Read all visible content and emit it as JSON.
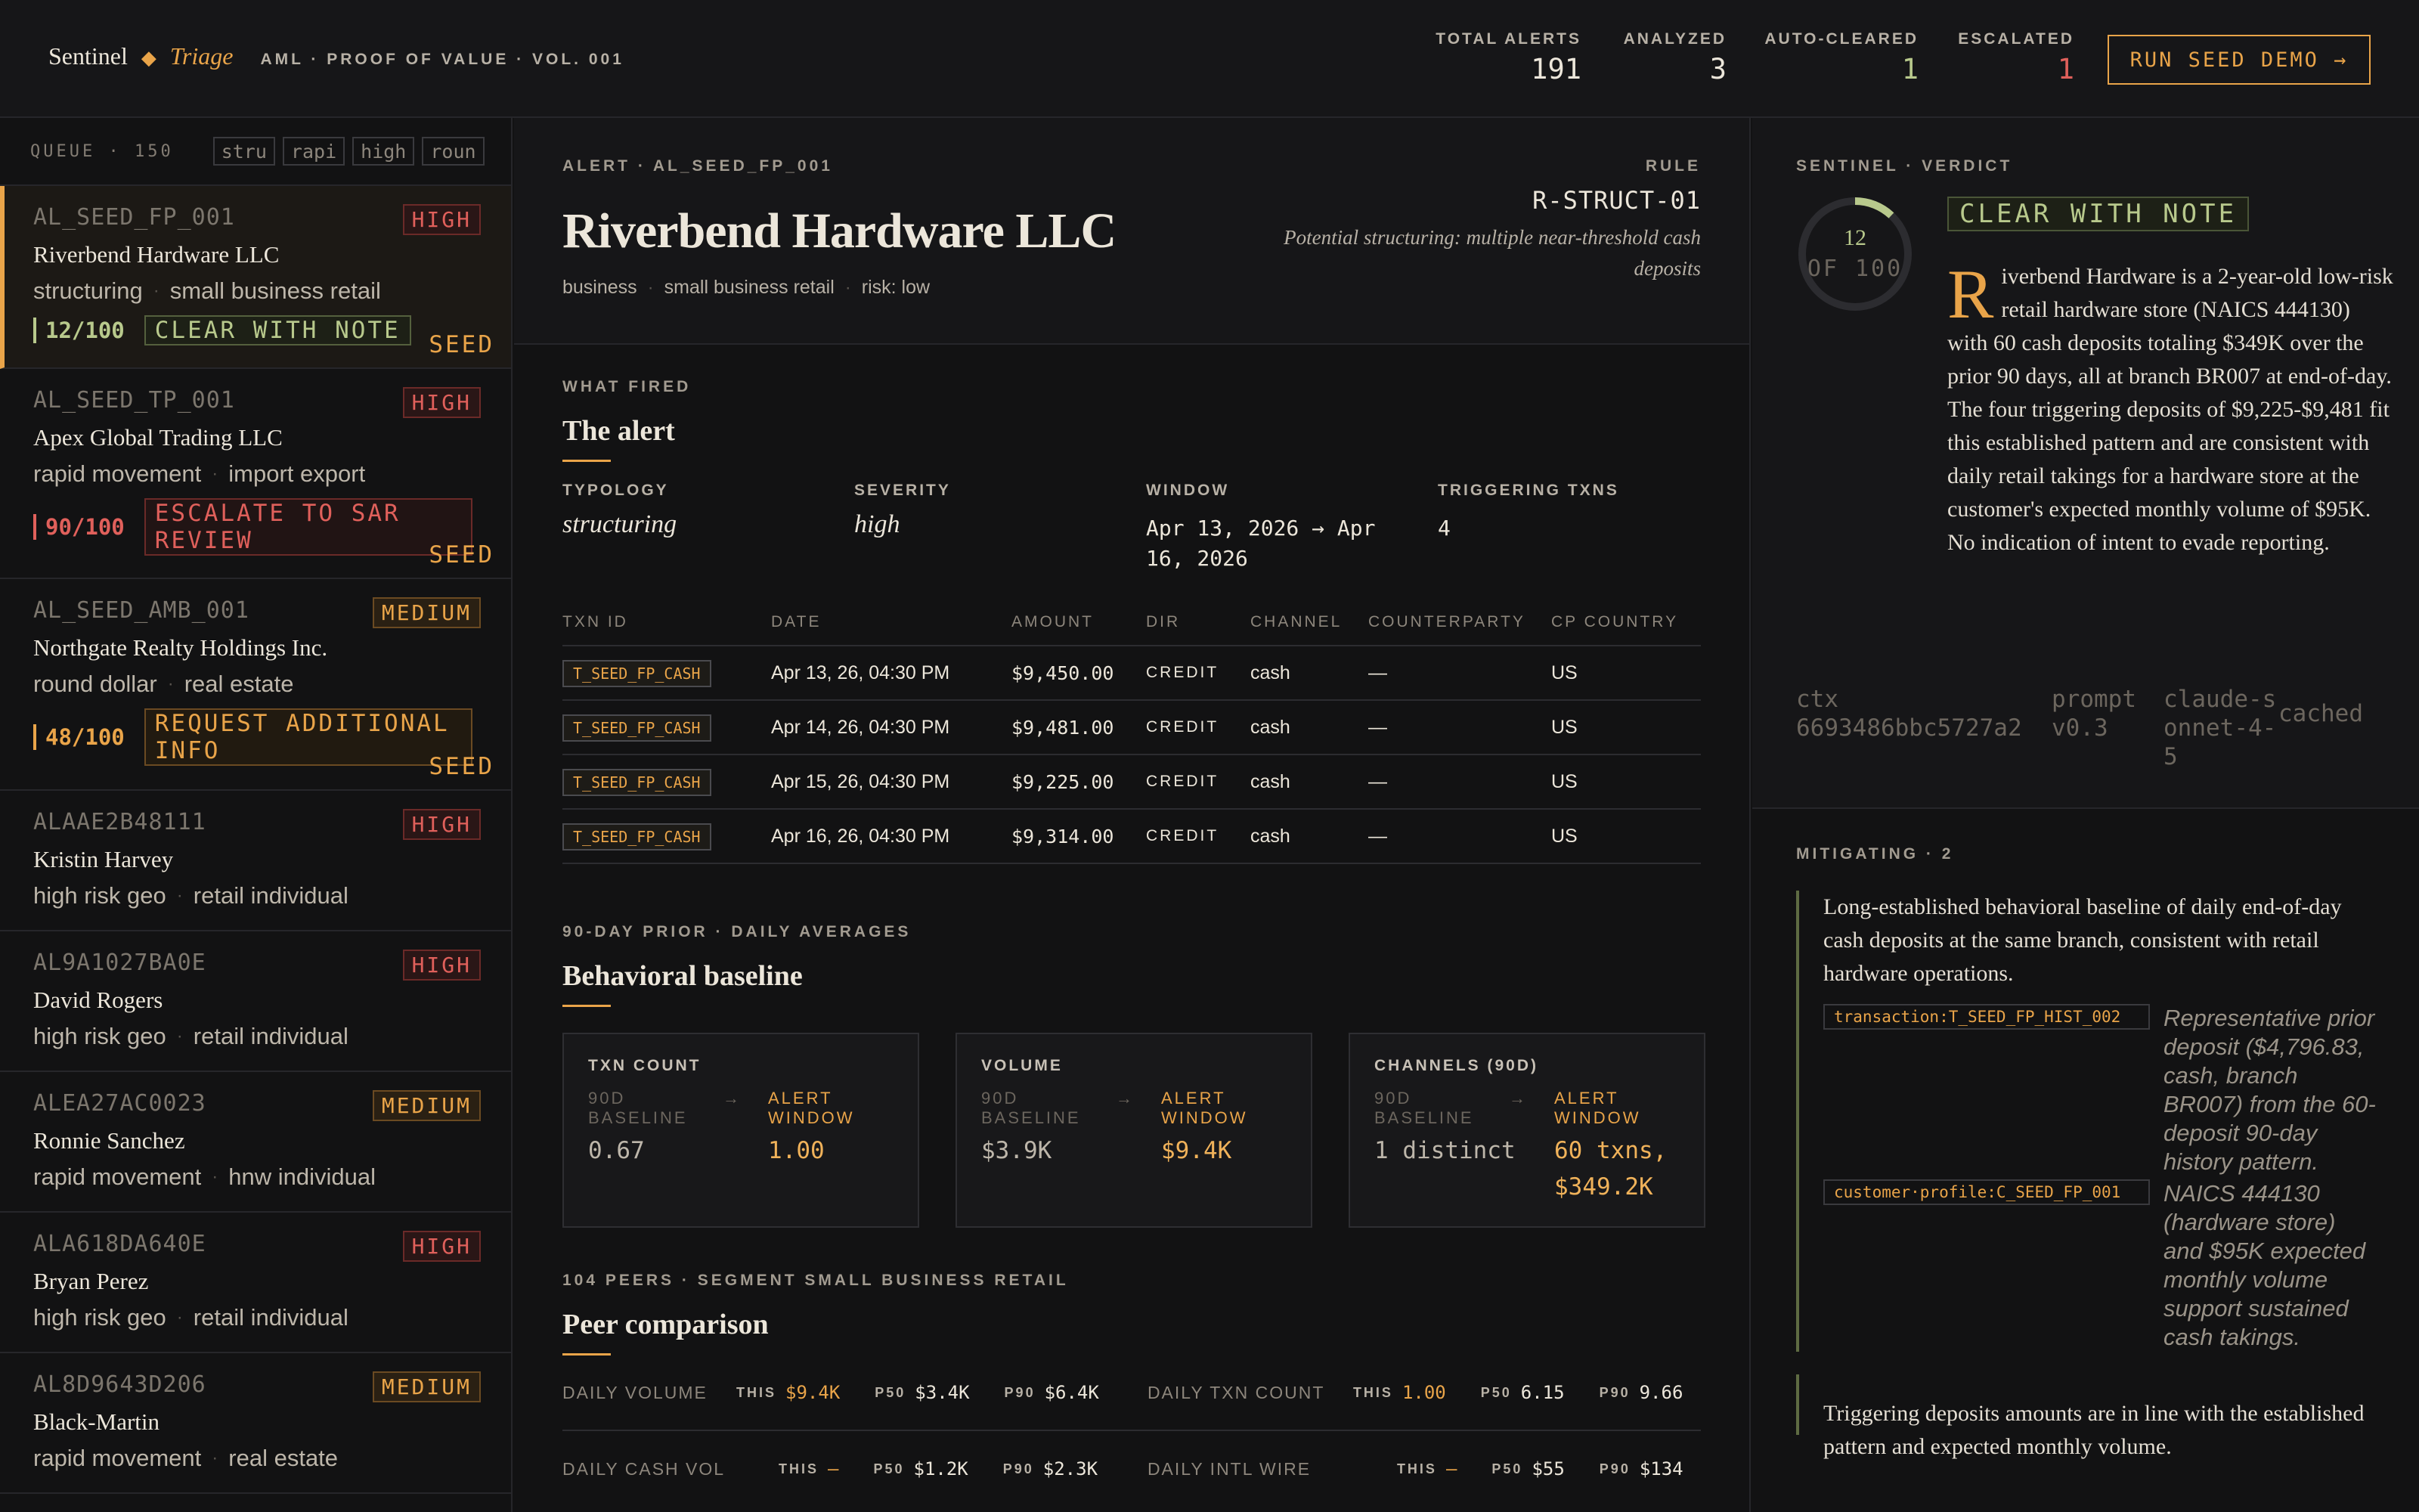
{
  "header": {
    "brand_name": "Sentinel",
    "brand_mark": "◆",
    "brand_sub": "Triage",
    "tagline": "AML · PROOF OF VALUE · VOL. 001",
    "stats": [
      {
        "label": "TOTAL ALERTS",
        "value": "191",
        "color": "#ece6da"
      },
      {
        "label": "ANALYZED",
        "value": "3",
        "color": "#ece6da"
      },
      {
        "label": "AUTO-CLEARED",
        "value": "1",
        "color": "#b8c98c"
      },
      {
        "label": "ESCALATED",
        "value": "1",
        "color": "#e0605b"
      }
    ],
    "run_button": "RUN SEED DEMO →"
  },
  "queue": {
    "label": "QUEUE · 150",
    "filters": [
      "stru",
      "rapi",
      "high",
      "roun"
    ],
    "items": [
      {
        "id": "AL_SEED_FP_001",
        "severity": "HIGH",
        "name": "Riverbend Hardware LLC",
        "tag1": "structuring",
        "tag2": "small business retail",
        "score": "12/100",
        "decision": "CLEAR WITH NOTE",
        "seed": "SEED"
      },
      {
        "id": "AL_SEED_TP_001",
        "severity": "HIGH",
        "name": "Apex Global Trading LLC",
        "tag1": "rapid movement",
        "tag2": "import export",
        "score": "90/100",
        "decision": "ESCALATE TO SAR REVIEW",
        "seed": "SEED"
      },
      {
        "id": "AL_SEED_AMB_001",
        "severity": "MEDIUM",
        "name": "Northgate Realty Holdings Inc.",
        "tag1": "round dollar",
        "tag2": "real estate",
        "score": "48/100",
        "decision": "REQUEST ADDITIONAL INFO",
        "seed": "SEED"
      },
      {
        "id": "ALAAE2B48111",
        "severity": "HIGH",
        "name": "Kristin Harvey",
        "tag1": "high risk geo",
        "tag2": "retail individual"
      },
      {
        "id": "AL9A1027BA0E",
        "severity": "HIGH",
        "name": "David Rogers",
        "tag1": "high risk geo",
        "tag2": "retail individual"
      },
      {
        "id": "ALEA27AC0023",
        "severity": "MEDIUM",
        "name": "Ronnie Sanchez",
        "tag1": "rapid movement",
        "tag2": "hnw individual"
      },
      {
        "id": "ALA618DA640E",
        "severity": "HIGH",
        "name": "Bryan Perez",
        "tag1": "high risk geo",
        "tag2": "retail individual"
      },
      {
        "id": "AL8D9643D206",
        "severity": "MEDIUM",
        "name": "Black-Martin",
        "tag1": "rapid movement",
        "tag2": "real estate"
      }
    ]
  },
  "alert": {
    "eyebrow": "ALERT · AL_SEED_FP_001",
    "title": "Riverbend Hardware LLC",
    "meta": [
      "business",
      "small business retail",
      "risk: low"
    ],
    "rule_label": "RULE",
    "rule_code": "R-STRUCT-01",
    "rule_desc": "Potential structuring: multiple near-threshold cash deposits"
  },
  "what_fired": {
    "eyebrow": "WHAT FIRED",
    "title": "The alert",
    "fields": [
      {
        "label": "TYPOLOGY",
        "value": "structuring"
      },
      {
        "label": "SEVERITY",
        "value": "high"
      },
      {
        "label": "WINDOW",
        "value": "Apr 13, 2026 → Apr 16, 2026"
      },
      {
        "label": "TRIGGERING TXNS",
        "value": "4"
      }
    ],
    "columns": [
      "TXN ID",
      "DATE",
      "AMOUNT",
      "DIR",
      "CHANNEL",
      "COUNTERPARTY",
      "CP COUNTRY"
    ],
    "rows": [
      [
        "T_SEED_FP_CASH",
        "Apr 13, 26, 04:30 PM",
        "$9,450.00",
        "CREDIT",
        "cash",
        "—",
        "US"
      ],
      [
        "T_SEED_FP_CASH",
        "Apr 14, 26, 04:30 PM",
        "$9,481.00",
        "CREDIT",
        "cash",
        "—",
        "US"
      ],
      [
        "T_SEED_FP_CASH",
        "Apr 15, 26, 04:30 PM",
        "$9,225.00",
        "CREDIT",
        "cash",
        "—",
        "US"
      ],
      [
        "T_SEED_FP_CASH",
        "Apr 16, 26, 04:30 PM",
        "$9,314.00",
        "CREDIT",
        "cash",
        "—",
        "US"
      ]
    ]
  },
  "baseline": {
    "eyebrow": "90-DAY PRIOR · DAILY AVERAGES",
    "title": "Behavioral baseline",
    "arrow": "→",
    "cards": [
      {
        "label": "TXN COUNT",
        "sub_left": "90D BASELINE",
        "sub_right": "ALERT WINDOW",
        "left": "0.67",
        "right": "1.00"
      },
      {
        "label": "VOLUME",
        "sub_left": "90D BASELINE",
        "sub_right": "ALERT WINDOW",
        "left": "$3.9K",
        "right": "$9.4K"
      },
      {
        "label": "CHANNELS (90D)",
        "sub_left": "90D BASELINE",
        "sub_right": "ALERT WINDOW",
        "left": "1 distinct",
        "right": "60 txns, $349.2K"
      }
    ]
  },
  "peers": {
    "eyebrow": "104 PEERS · SEGMENT SMALL BUSINESS RETAIL",
    "title": "Peer comparison",
    "k_this": "THIS",
    "k_p50": "P50",
    "k_p90": "P90",
    "rows": [
      [
        {
          "name": "DAILY VOLUME",
          "this": "$9.4K",
          "p50": "$3.4K",
          "p90": "$6.4K"
        },
        {
          "name": "DAILY TXN COUNT",
          "this": "1.00",
          "p50": "6.15",
          "p90": "9.66"
        }
      ],
      [
        {
          "name": "DAILY CASH VOL",
          "this": "—",
          "p50": "$1.2K",
          "p90": "$2.3K"
        },
        {
          "name": "DAILY INTL WIRE",
          "this": "—",
          "p50": "$55",
          "p90": "$134"
        }
      ]
    ]
  },
  "verdict": {
    "eyebrow": "SENTINEL · VERDICT",
    "score": 12,
    "score_text": "12",
    "score_of": "OF 100",
    "badge": "CLEAR WITH NOTE",
    "drop_cap": "R",
    "rationale": "iverbend Hardware is a 2-year-old low-risk retail hardware store (NAICS 444130) with 60 cash deposits totaling $349K over the prior 90 days, all at branch BR007 at end-of-day. The four triggering deposits of $9,225-$9,481 fit this established pattern and are consistent with daily retail takings for a hardware store at the customer's expected monthly volume of $95K. No indication of intent to evade reporting.",
    "ctx_label": "ctx",
    "ctx_value": "6693486bbc5727a2",
    "prompt_label": "prompt",
    "prompt_value": "v0.3",
    "model_value": "claude-sonnet-4-5",
    "cached": "cached"
  },
  "mitigating": {
    "eyebrow": "MITIGATING · 2",
    "items": [
      {
        "text": "Long-established behavioral baseline of daily end-of-day cash deposits at the same branch, consistent with retail hardware operations.",
        "evidence": [
          {
            "ref": "transaction:T_SEED_FP_HIST_002",
            "desc": "Representative prior deposit ($4,796.83, cash, branch BR007) from the 60-deposit 90-day history pattern."
          },
          {
            "ref": "customer·profile:C_SEED_FP_001",
            "desc": "NAICS 444130 (hardware store) and $95K expected monthly volume support sustained cash takings."
          }
        ]
      },
      {
        "text": "Triggering deposits amounts are in line with the established pattern and expected monthly volume."
      }
    ]
  },
  "colors": {
    "accent": "#e9a449",
    "clear": "#b8c98c",
    "escalate": "#e0605b",
    "background": "#121213"
  }
}
